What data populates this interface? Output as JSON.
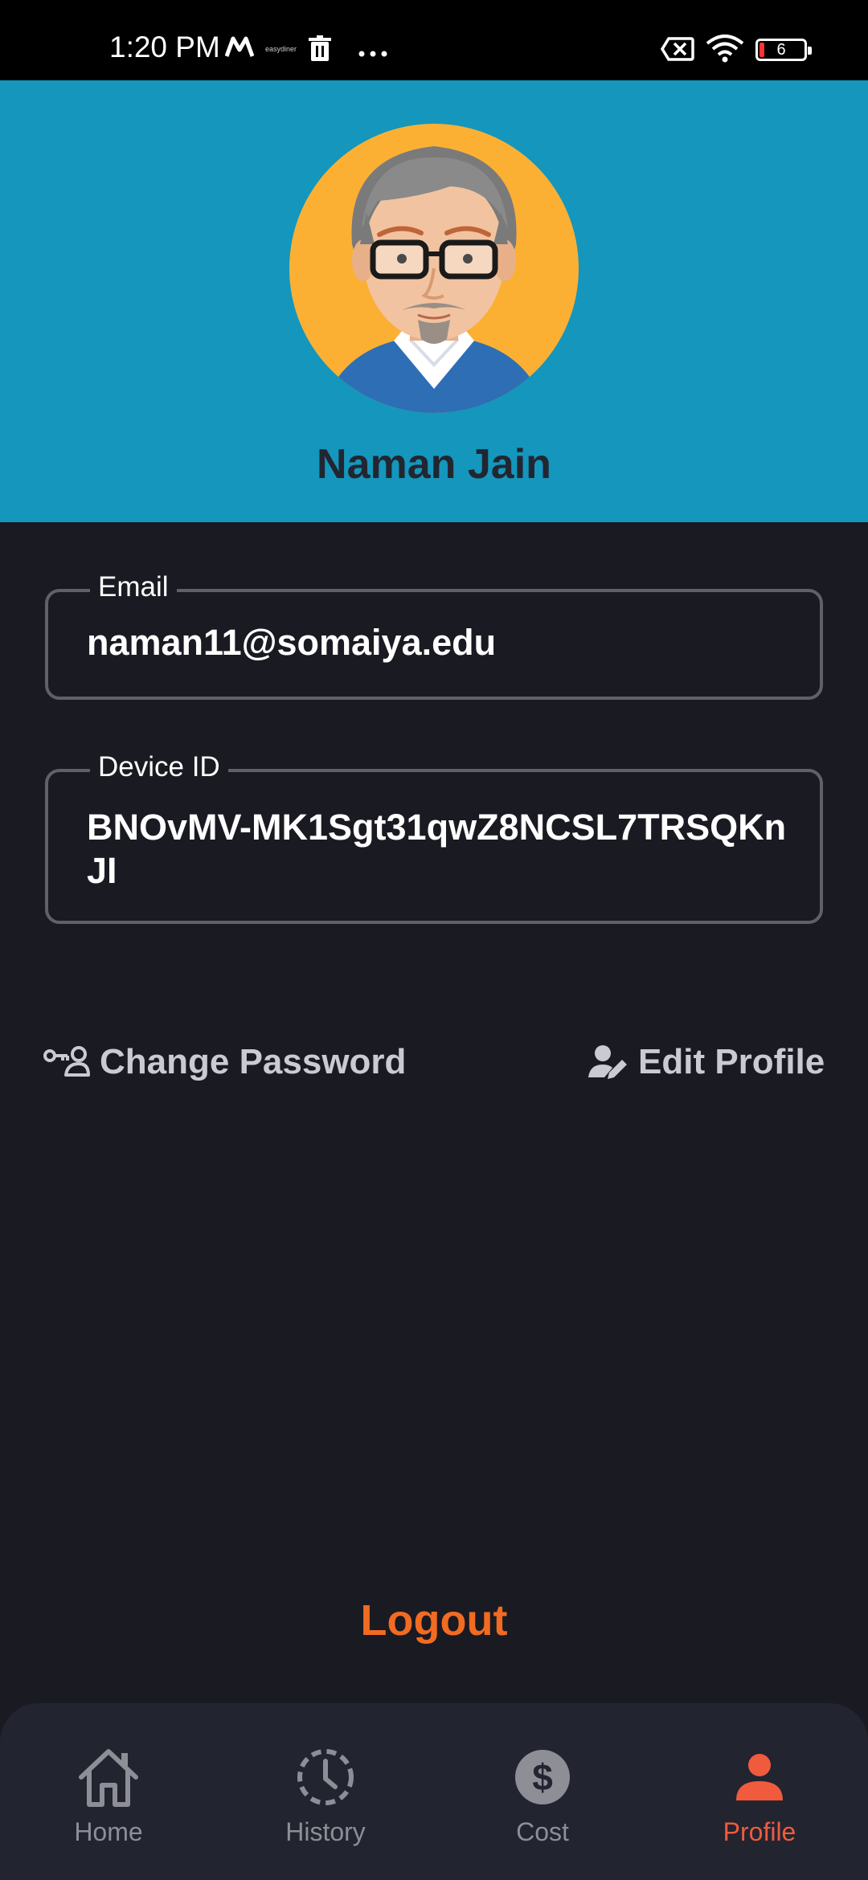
{
  "status_bar": {
    "time": "1:20 PM",
    "tiny_text": "easydiner",
    "battery": "6"
  },
  "profile": {
    "name": "Naman Jain",
    "avatar_icon": "avatar-illustration"
  },
  "fields": {
    "email": {
      "label": "Email",
      "value": "naman11@somaiya.edu"
    },
    "device_id": {
      "label": "Device ID",
      "value": "BNOvMV-MK1Sgt31qwZ8NCSL7TRSQKnJI"
    }
  },
  "actions": {
    "change_password": "Change Password",
    "edit_profile": "Edit Profile"
  },
  "logout": "Logout",
  "nav": {
    "items": [
      {
        "label": "Home",
        "icon": "home-icon"
      },
      {
        "label": "History",
        "icon": "history-icon"
      },
      {
        "label": "Cost",
        "icon": "dollar-icon"
      },
      {
        "label": "Profile",
        "icon": "person-icon"
      }
    ],
    "active": "Profile"
  },
  "colors": {
    "header_bg": "#1496bd",
    "page_bg": "#1a1a22",
    "accent": "#f26b22",
    "active_tab": "#ef5b3c"
  }
}
